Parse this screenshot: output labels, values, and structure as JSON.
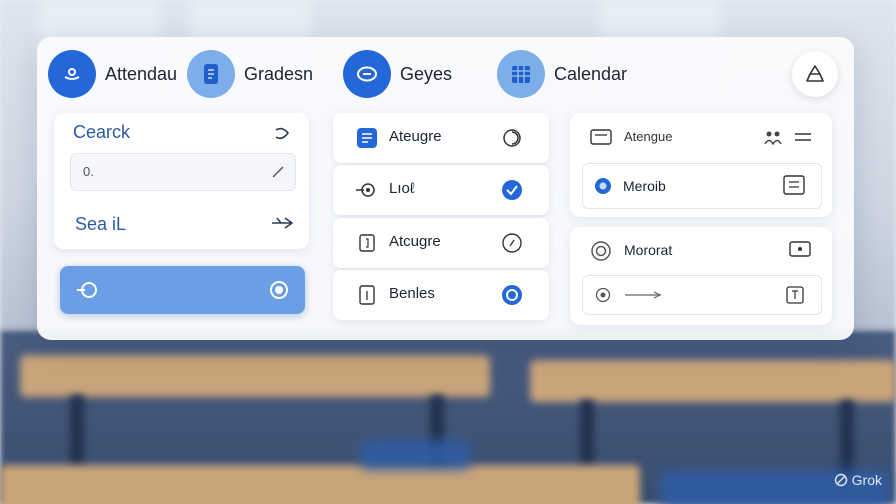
{
  "nav": [
    {
      "label": "Attendau",
      "icon": "smile-icon"
    },
    {
      "label": "Gradesn",
      "icon": "document-icon"
    },
    {
      "label": "Geyes",
      "icon": "chat-icon"
    },
    {
      "label": "Calendar",
      "icon": "calendar-icon"
    }
  ],
  "corner_icon": "recycle-icon",
  "left_panel": {
    "search_title": "Cearck",
    "input_value": "0.",
    "search_label2": "Sea iL"
  },
  "middle_list": [
    {
      "label": "Ateugre",
      "left_icon": "document-icon",
      "right_icon": "circle-outline-icon"
    },
    {
      "label": "Lıoℓ",
      "left_icon": "target-icon",
      "right_icon": "check-badge-icon"
    },
    {
      "label": "Atcugre",
      "left_icon": "doc-bracket-icon",
      "right_icon": "circle-outline-icon"
    },
    {
      "label": "Benles",
      "left_icon": "file-icon",
      "right_icon": "record-icon"
    }
  ],
  "right_top": {
    "label1": "Atengue",
    "label2": "Meroib"
  },
  "right_bottom": {
    "label1": "Mororat"
  },
  "watermark": "Grok",
  "colors": {
    "accent": "#2367d8",
    "accent_light": "#7eaee9",
    "selected_row": "#6a9fe6"
  }
}
